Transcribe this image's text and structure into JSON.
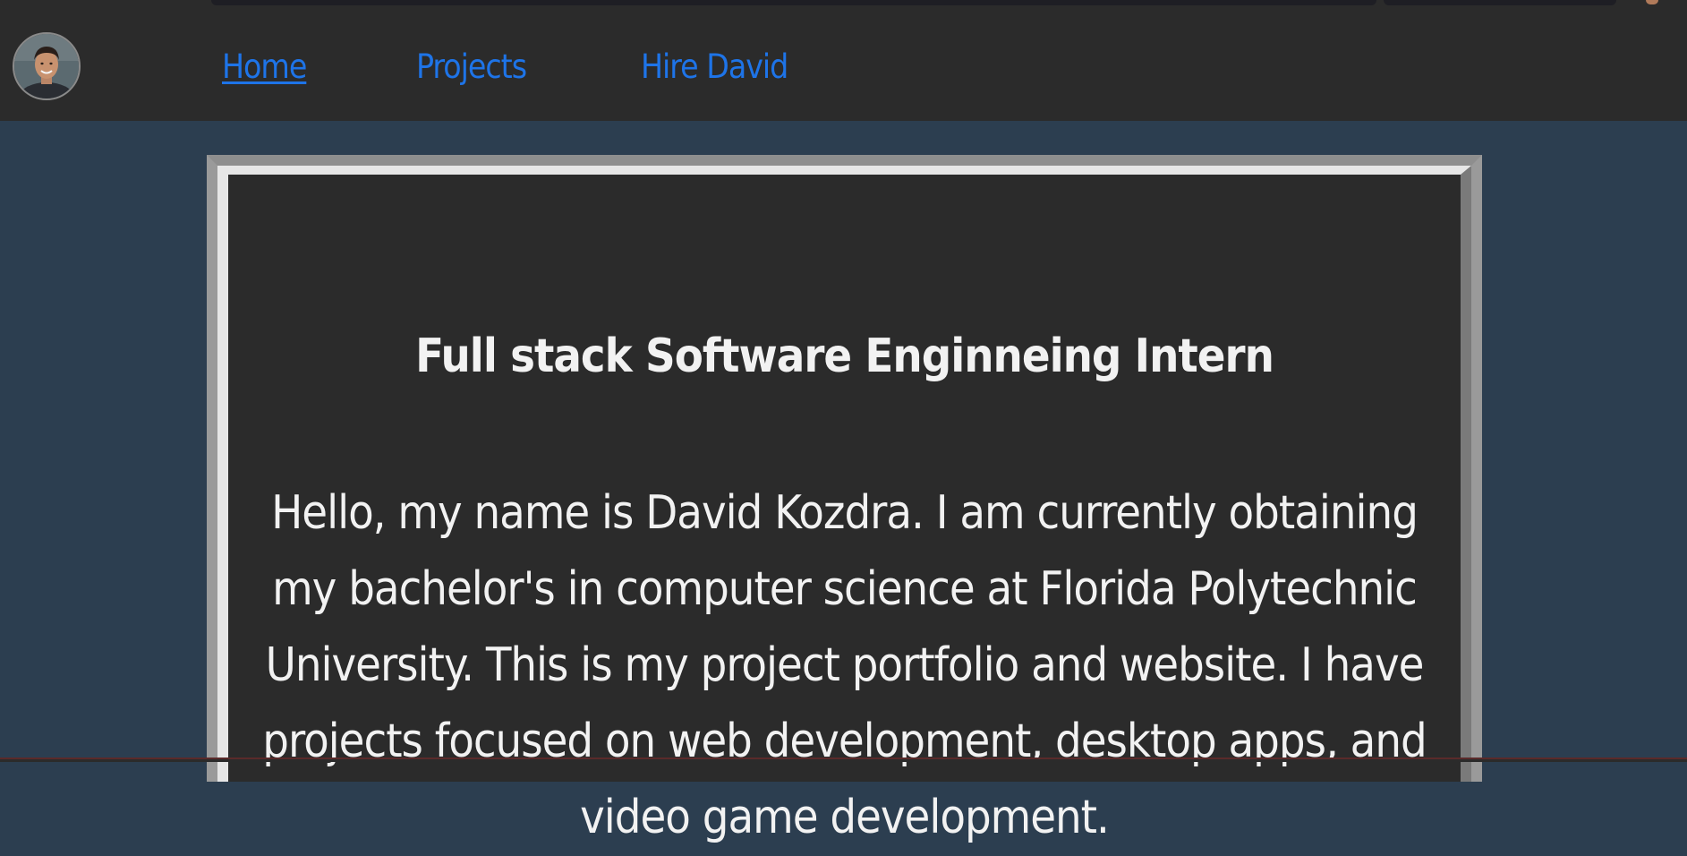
{
  "nav": {
    "links": [
      {
        "label": "Home",
        "active": true
      },
      {
        "label": "Projects",
        "active": false
      },
      {
        "label": "Hire David",
        "active": false
      }
    ],
    "link_color": "#1e74e8"
  },
  "main": {
    "headline": "Full stack Software Enginneing Intern",
    "intro": "Hello, my name is David Kozdra. I am currently obtaining my bachelor's in computer science at Florida Polytechnic University. This is my project portfolio and website. I have projects focused on web development, desktop apps, and video game development."
  },
  "colors": {
    "page_background": "#2c3e50",
    "navbar_background": "#2b2b2b",
    "card_background": "#2b2b2b",
    "text": "#f2f2f2"
  }
}
